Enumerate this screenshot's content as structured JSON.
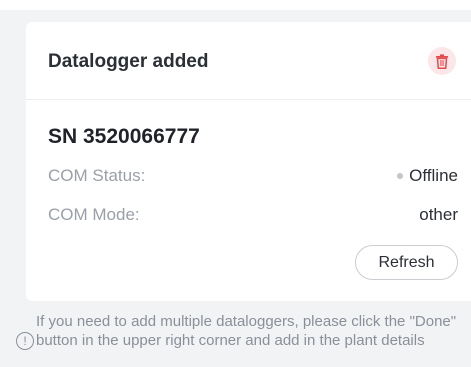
{
  "card": {
    "title": "Datalogger added",
    "delete_icon": "trash-icon",
    "serial": "SN 3520066777",
    "com_status_label": "COM Status:",
    "com_status_value": "Offline",
    "com_mode_label": "COM Mode:",
    "com_mode_value": "other",
    "refresh_label": "Refresh"
  },
  "notice": {
    "icon": "info-icon",
    "text": "If you need to add multiple dataloggers, please click the \"Done\" button in the upper right corner and add in the plant details"
  },
  "colors": {
    "background": "#f2f3f5",
    "card": "#ffffff",
    "delete_icon": "#e5484d",
    "offline_dot": "#c3c7cd"
  }
}
